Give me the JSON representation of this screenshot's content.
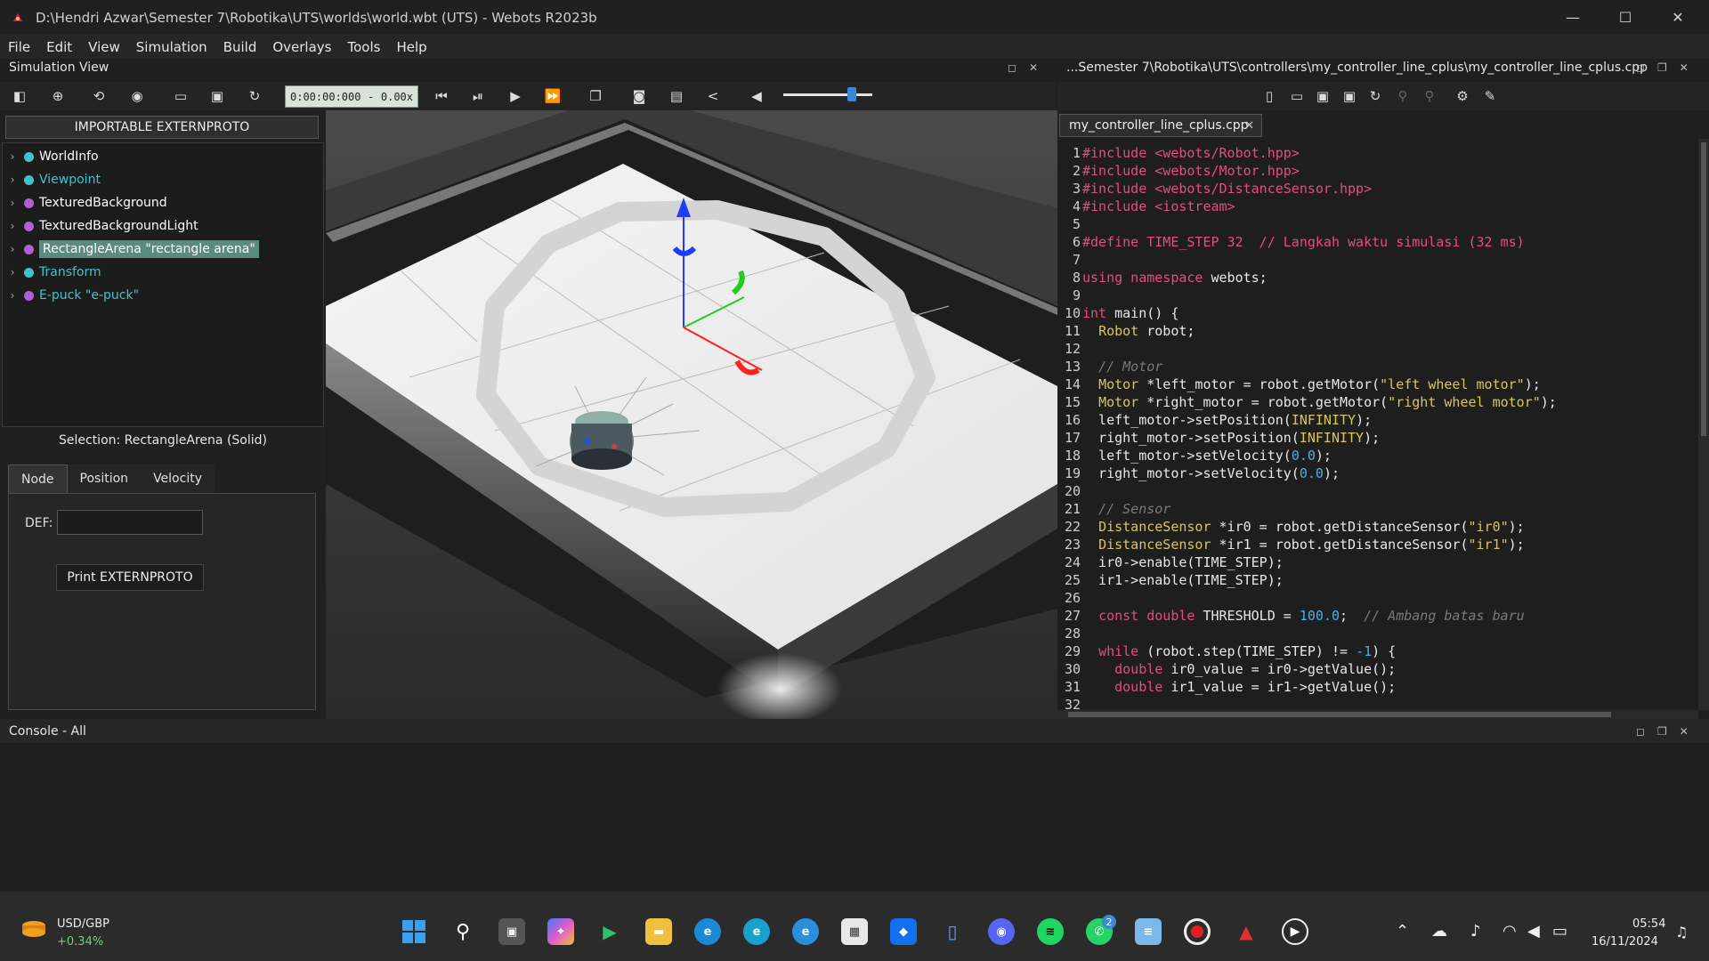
{
  "window": {
    "title": "D:\\Hendri Azwar\\Semester 7\\Robotika\\UTS\\worlds\\world.wbt (UTS) - Webots R2023b",
    "minimize": "—",
    "maximize": "☐",
    "close": "✕"
  },
  "menu": [
    "File",
    "Edit",
    "View",
    "Simulation",
    "Build",
    "Overlays",
    "Tools",
    "Help"
  ],
  "simulation_view": {
    "title": "Simulation View",
    "time": "0:00:00:000",
    "separator": "-",
    "speed": "0.00x"
  },
  "scene_tree": {
    "import_button": "IMPORTABLE EXTERNPROTO",
    "items": [
      {
        "label": "WorldInfo",
        "color": "#3ec4d0",
        "text_color": "#ffffff"
      },
      {
        "label": "Viewpoint",
        "color": "#3ec4d0",
        "text_color": "#3ec4d0"
      },
      {
        "label": "TexturedBackground",
        "color": "#b05fd8",
        "text_color": "#ffffff"
      },
      {
        "label": "TexturedBackgroundLight",
        "color": "#b05fd8",
        "text_color": "#ffffff"
      },
      {
        "label": "RectangleArena \"rectangle arena\"",
        "color": "#b05fd8",
        "text_color": "#ffffff",
        "selected": true
      },
      {
        "label": "Transform",
        "color": "#3ec4d0",
        "text_color": "#3ec4d0"
      },
      {
        "label": "E-puck \"e-puck\"",
        "color": "#b05fd8",
        "text_color": "#3ec4d0"
      }
    ]
  },
  "selection": {
    "title": "Selection: RectangleArena (Solid)",
    "tabs": [
      "Node",
      "Position",
      "Velocity"
    ],
    "def_label": "DEF:",
    "def_value": "",
    "print_button": "Print EXTERNPROTO"
  },
  "editor": {
    "title": "...Semester 7\\Robotika\\UTS\\controllers\\my_controller_line_cplus\\my_controller_line_cplus.cpp",
    "tab": "my_controller_line_cplus.cpp",
    "tab_close": "✕",
    "lines": [
      "1",
      "2",
      "3",
      "4",
      "5",
      "6",
      "7",
      "8",
      "9",
      "10",
      "11",
      "12",
      "13",
      "14",
      "15",
      "16",
      "17",
      "18",
      "19",
      "20",
      "21",
      "22",
      "23",
      "24",
      "25",
      "26",
      "27",
      "28",
      "29",
      "30",
      "31",
      "32"
    ]
  },
  "console": {
    "title": "Console - All"
  },
  "taskbar": {
    "ticker_name": "USD/GBP",
    "ticker_change": "+0.34%",
    "time": "05:54",
    "date": "16/11/2024",
    "whatsapp_badge": "2"
  }
}
